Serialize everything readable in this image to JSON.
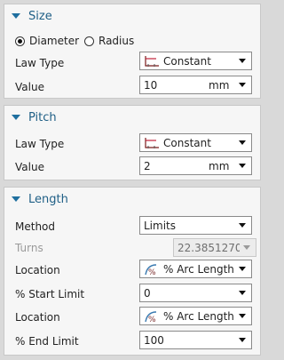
{
  "size": {
    "title": "Size",
    "radio_diameter": "Diameter",
    "radio_radius": "Radius",
    "selected": "Diameter",
    "law_type_label": "Law Type",
    "law_type_value": "Constant",
    "value_label": "Value",
    "value": "10",
    "unit": "mm"
  },
  "pitch": {
    "title": "Pitch",
    "law_type_label": "Law Type",
    "law_type_value": "Constant",
    "value_label": "Value",
    "value": "2",
    "unit": "mm"
  },
  "length": {
    "title": "Length",
    "method_label": "Method",
    "method_value": "Limits",
    "turns_label": "Turns",
    "turns_value": "22.3851270",
    "location1_label": "Location",
    "location1_value": "% Arc Length",
    "start_limit_label": "% Start Limit",
    "start_limit_value": "0",
    "location2_label": "Location",
    "location2_value": "% Arc Length",
    "end_limit_label": "% End Limit",
    "end_limit_value": "100"
  },
  "icons": {
    "law_icon": "constant-law-icon",
    "location_icon": "arc-length-icon",
    "dropdown": "chevron-down-icon",
    "section_toggle": "collapse-triangle-icon"
  }
}
